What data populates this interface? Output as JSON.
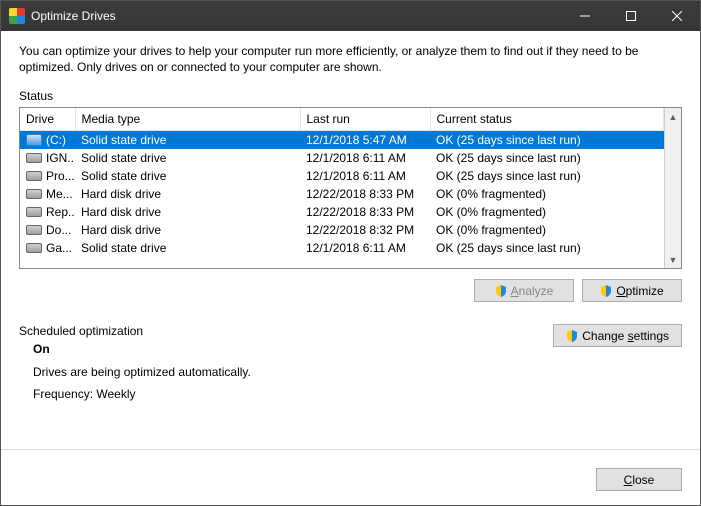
{
  "window": {
    "title": "Optimize Drives"
  },
  "intro": "You can optimize your drives to help your computer run more efficiently, or analyze them to find out if they need to be optimized. Only drives on or connected to your computer are shown.",
  "status_label": "Status",
  "columns": {
    "drive": "Drive",
    "media": "Media type",
    "last_run": "Last run",
    "current_status": "Current status"
  },
  "rows": [
    {
      "drive": "(C:)",
      "media": "Solid state drive",
      "last_run": "12/1/2018 5:47 AM",
      "status": "OK (25 days since last run)",
      "selected": true,
      "icon": "c"
    },
    {
      "drive": "IGN...",
      "media": "Solid state drive",
      "last_run": "12/1/2018 6:11 AM",
      "status": "OK (25 days since last run)",
      "selected": false,
      "icon": "hdd"
    },
    {
      "drive": "Pro...",
      "media": "Solid state drive",
      "last_run": "12/1/2018 6:11 AM",
      "status": "OK (25 days since last run)",
      "selected": false,
      "icon": "hdd"
    },
    {
      "drive": "Me...",
      "media": "Hard disk drive",
      "last_run": "12/22/2018 8:33 PM",
      "status": "OK (0% fragmented)",
      "selected": false,
      "icon": "hdd"
    },
    {
      "drive": "Rep...",
      "media": "Hard disk drive",
      "last_run": "12/22/2018 8:33 PM",
      "status": "OK (0% fragmented)",
      "selected": false,
      "icon": "hdd"
    },
    {
      "drive": "Do...",
      "media": "Hard disk drive",
      "last_run": "12/22/2018 8:32 PM",
      "status": "OK (0% fragmented)",
      "selected": false,
      "icon": "hdd"
    },
    {
      "drive": "Ga...",
      "media": "Solid state drive",
      "last_run": "12/1/2018 6:11 AM",
      "status": "OK (25 days since last run)",
      "selected": false,
      "icon": "hdd"
    }
  ],
  "buttons": {
    "analyze": "Analyze",
    "optimize": "Optimize",
    "change_settings": "Change settings",
    "close": "Close"
  },
  "scheduled": {
    "heading": "Scheduled optimization",
    "state": "On",
    "desc": "Drives are being optimized automatically.",
    "freq": "Frequency: Weekly"
  }
}
